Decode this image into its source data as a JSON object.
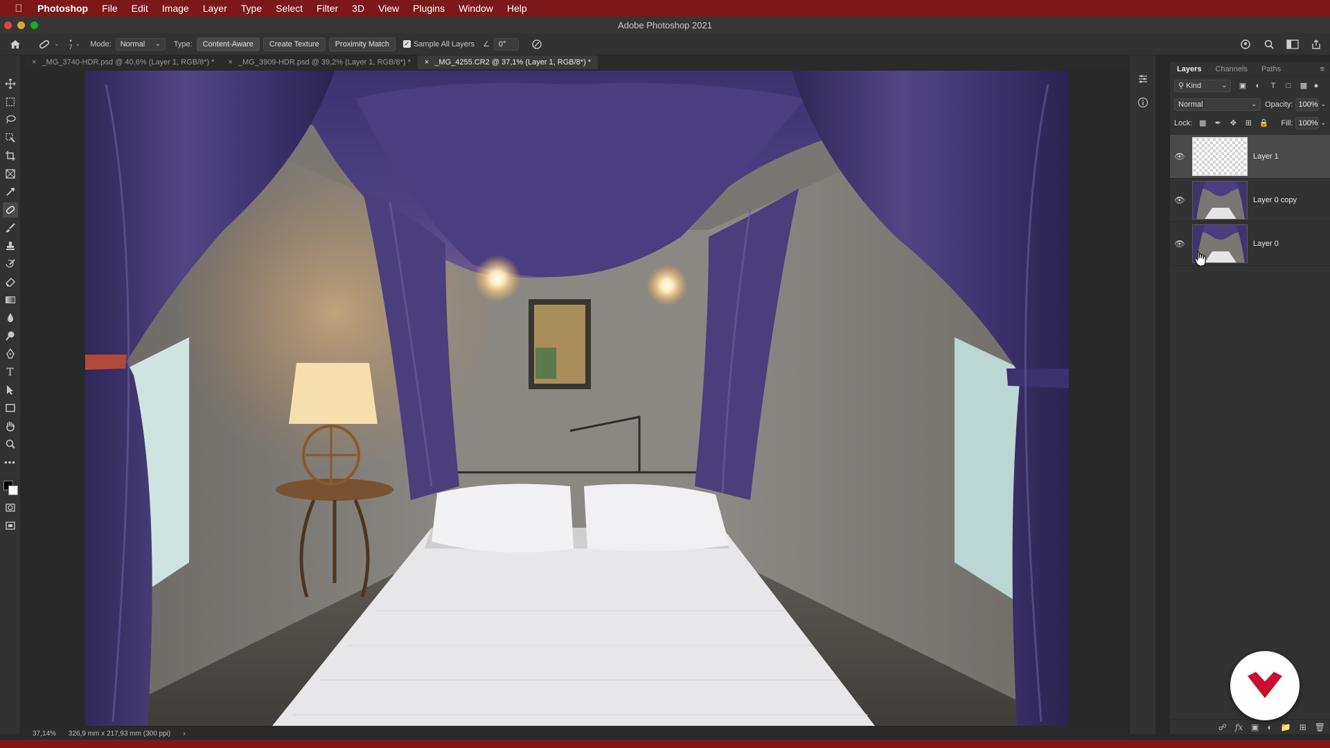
{
  "menubar": {
    "app_name": "Photoshop",
    "items": [
      "File",
      "Edit",
      "Image",
      "Layer",
      "Type",
      "Select",
      "Filter",
      "3D",
      "View",
      "Plugins",
      "Window",
      "Help"
    ]
  },
  "window": {
    "title": "Adobe Photoshop 2021"
  },
  "options_bar": {
    "brush_size": "7",
    "mode_label": "Mode:",
    "mode_value": "Normal",
    "type_label": "Type:",
    "type_buttons": [
      "Content-Aware",
      "Create Texture",
      "Proximity Match"
    ],
    "sample_all_layers": "Sample All Layers",
    "angle_value": "0°"
  },
  "tabs": [
    {
      "label": "_MG_3740-HDR.psd @ 40,6% (Layer 1, RGB/8*) *",
      "active": false
    },
    {
      "label": "_MG_3909-HDR.psd @ 39,2% (Layer 1, RGB/8*) *",
      "active": false
    },
    {
      "label": "_MG_4255.CR2 @ 37,1% (Layer 1, RGB/8*) *",
      "active": true
    }
  ],
  "layers_panel": {
    "tabs": [
      "Layers",
      "Channels",
      "Paths"
    ],
    "filter_kind": "Kind",
    "blend_mode": "Normal",
    "opacity_label": "Opacity:",
    "opacity_value": "100%",
    "lock_label": "Lock:",
    "fill_label": "Fill:",
    "fill_value": "100%",
    "layers": [
      {
        "name": "Layer 1",
        "active": true,
        "thumb": "transparent"
      },
      {
        "name": "Layer 0 copy",
        "active": false,
        "thumb": "photo"
      },
      {
        "name": "Layer 0",
        "active": false,
        "thumb": "photo"
      }
    ]
  },
  "status_bar": {
    "zoom": "37,14%",
    "doc_size": "326,9 mm x 217,93 mm (300 ppi)"
  },
  "colors": {
    "menubar_bg": "#7d1818",
    "drape_purple": "#4b3e7c",
    "badge_red": "#c8102e"
  }
}
